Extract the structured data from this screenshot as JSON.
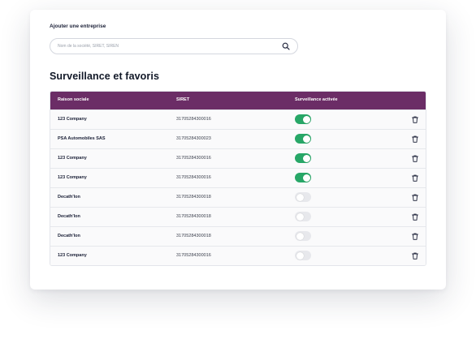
{
  "add_company": {
    "label": "Ajouter une entreprise",
    "search_placeholder": "Nom de la société, SIRET, SIREN",
    "search_value": ""
  },
  "section": {
    "title": "Surveillance et favoris"
  },
  "table": {
    "headers": {
      "name": "Raison sociale",
      "siret": "SIRET",
      "monitoring": "Surveillance activée"
    },
    "rows": [
      {
        "name": "123 Company",
        "siret": "31705284300016",
        "monitoring": true
      },
      {
        "name": "PSA Automobiles SAS",
        "siret": "31705284300023",
        "monitoring": true
      },
      {
        "name": "123 Company",
        "siret": "31705284300016",
        "monitoring": true
      },
      {
        "name": "123 Company",
        "siret": "31705284300016",
        "monitoring": true
      },
      {
        "name": "Decath'lon",
        "siret": "31705284300018",
        "monitoring": false
      },
      {
        "name": "Decath'lon",
        "siret": "31705284300018",
        "monitoring": false
      },
      {
        "name": "Decath'lon",
        "siret": "31705284300018",
        "monitoring": false
      },
      {
        "name": "123 Company",
        "siret": "31705284300016",
        "monitoring": false
      }
    ]
  },
  "colors": {
    "header_bg": "#6b2d66",
    "toggle_on": "#27a767",
    "toggle_off": "#e7e8ec"
  },
  "icons": {
    "search": "search-icon",
    "delete": "trash-icon"
  }
}
